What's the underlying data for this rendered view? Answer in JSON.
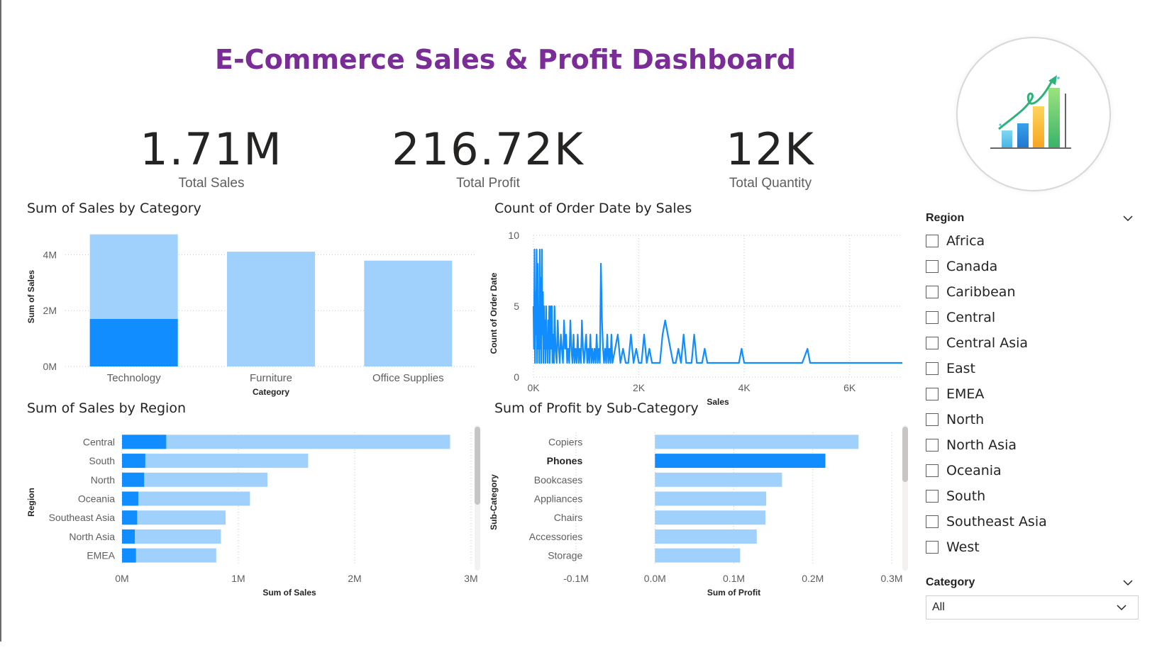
{
  "dashboard": {
    "title": "E-Commerce Sales & Profit Dashboard",
    "accent_color": "#7a2d96",
    "logo_icon": "growth-chart-icon"
  },
  "kpis": [
    {
      "value": "1.71M",
      "label": "Total Sales"
    },
    {
      "value": "216.72K",
      "label": "Total Profit"
    },
    {
      "value": "12K",
      "label": "Total Quantity"
    }
  ],
  "chart_data": [
    {
      "id": "sales-by-category",
      "type": "bar",
      "title": "Sum of Sales by Category",
      "xlabel": "Category",
      "ylabel": "Sum of Sales",
      "categories": [
        "Technology",
        "Furniture",
        "Office Supplies"
      ],
      "values": [
        4730000,
        4110000,
        3790000
      ],
      "highlighted_values": [
        1700000,
        null,
        null
      ],
      "yticks": [
        "0M",
        "2M",
        "4M"
      ],
      "ylim": [
        0,
        5000000
      ],
      "grid": true,
      "colors": {
        "base": "#a0d1fc",
        "highlight": "#118dff"
      }
    },
    {
      "id": "order-date-by-sales",
      "type": "line",
      "title": "Count of Order Date by Sales",
      "xlabel": "Sales",
      "ylabel": "Count of Order Date",
      "xticks": [
        "0K",
        "2K",
        "4K",
        "6K"
      ],
      "yticks": [
        "0",
        "5",
        "10"
      ],
      "xlim": [
        0,
        7000
      ],
      "ylim": [
        0,
        10
      ],
      "grid": true,
      "color": "#118dff",
      "x": [
        0,
        10,
        20,
        30,
        40,
        50,
        60,
        70,
        80,
        90,
        100,
        110,
        120,
        130,
        140,
        150,
        160,
        170,
        180,
        190,
        200,
        210,
        220,
        230,
        240,
        250,
        260,
        270,
        280,
        290,
        300,
        310,
        320,
        330,
        340,
        350,
        360,
        370,
        380,
        390,
        400,
        420,
        440,
        460,
        480,
        500,
        520,
        540,
        560,
        580,
        600,
        620,
        640,
        660,
        680,
        700,
        720,
        740,
        760,
        780,
        800,
        820,
        840,
        860,
        880,
        900,
        920,
        940,
        960,
        980,
        1000,
        1020,
        1040,
        1060,
        1080,
        1100,
        1120,
        1140,
        1160,
        1180,
        1200,
        1220,
        1240,
        1260,
        1280,
        1300,
        1320,
        1340,
        1360,
        1380,
        1400,
        1420,
        1440,
        1460,
        1480,
        1500,
        1550,
        1600,
        1650,
        1700,
        1750,
        1800,
        1850,
        1900,
        1950,
        2000,
        2050,
        2100,
        2150,
        2200,
        2250,
        2300,
        2350,
        2400,
        2450,
        2500,
        2550,
        2600,
        2650,
        2700,
        2750,
        2800,
        2850,
        2900,
        2950,
        3000,
        3050,
        3100,
        3150,
        3200,
        3250,
        3300,
        3400,
        3500,
        3600,
        3700,
        3800,
        3900,
        3950,
        4000,
        4050,
        4100,
        4300,
        4600,
        4900,
        5100,
        5200,
        5250,
        5300,
        5500,
        5900,
        6300,
        6700,
        7000
      ],
      "y": [
        5,
        2,
        9,
        1,
        6,
        3,
        9,
        1,
        8,
        2,
        5,
        1,
        9,
        2,
        7,
        1,
        9,
        3,
        6,
        1,
        5,
        2,
        4,
        1,
        5,
        2,
        3,
        1,
        4,
        2,
        5,
        1,
        3,
        5,
        2,
        5,
        1,
        3,
        2,
        1,
        5,
        2,
        1,
        4,
        2,
        1,
        3,
        2,
        1,
        4,
        2,
        3,
        1,
        2,
        1,
        4,
        2,
        1,
        3,
        1,
        2,
        1,
        3,
        1,
        2,
        1,
        4,
        2,
        1,
        2,
        3,
        1,
        2,
        1,
        3,
        1,
        2,
        1,
        2,
        1,
        3,
        1,
        2,
        1,
        8,
        4,
        2,
        1,
        2,
        1,
        3,
        1,
        2,
        1,
        3,
        1,
        2,
        3,
        1,
        2,
        1,
        1,
        3,
        1,
        2,
        1,
        1,
        3,
        1,
        2,
        1,
        1,
        1,
        1,
        3,
        4,
        3,
        2,
        1,
        1,
        2,
        1,
        3,
        1,
        1,
        1,
        3,
        1,
        1,
        1,
        2,
        1,
        1,
        1,
        1,
        1,
        1,
        1,
        2,
        1,
        1,
        1,
        1,
        1,
        1,
        1,
        2,
        1,
        1,
        1,
        1,
        1,
        1,
        1
      ]
    },
    {
      "id": "sales-by-region",
      "type": "bar",
      "orientation": "horizontal",
      "title": "Sum of Sales by Region",
      "xlabel": "Sum of Sales",
      "ylabel": "Region",
      "categories": [
        "Central",
        "South",
        "North",
        "Oceania",
        "Southeast Asia",
        "North Asia",
        "EMEA"
      ],
      "values": [
        2820000,
        1600000,
        1250000,
        1100000,
        890000,
        850000,
        810000
      ],
      "highlighted_values": [
        380000,
        200000,
        190000,
        140000,
        130000,
        110000,
        120000
      ],
      "xticks": [
        "0M",
        "1M",
        "2M",
        "3M"
      ],
      "xlim": [
        0,
        3000000
      ],
      "grid": true,
      "colors": {
        "base": "#a0d1fc",
        "highlight": "#118dff"
      }
    },
    {
      "id": "profit-by-subcategory",
      "type": "bar",
      "orientation": "horizontal",
      "title": "Sum of Profit by Sub-Category",
      "xlabel": "Sum of Profit",
      "ylabel": "Sub-Category",
      "categories": [
        "Copiers",
        "Phones",
        "Bookcases",
        "Appliances",
        "Chairs",
        "Accessories",
        "Storage"
      ],
      "values": [
        258000,
        216000,
        161000,
        141000,
        140000,
        129000,
        108000
      ],
      "selected_category": "Phones",
      "xticks": [
        "-0.1M",
        "0.0M",
        "0.1M",
        "0.2M",
        "0.3M"
      ],
      "xlim": [
        -100000,
        300000
      ],
      "grid": true,
      "colors": {
        "base": "#a0d1fc",
        "highlight": "#118dff"
      }
    }
  ],
  "slicers": {
    "region": {
      "title": "Region",
      "items": [
        "Africa",
        "Canada",
        "Caribbean",
        "Central",
        "Central Asia",
        "East",
        "EMEA",
        "North",
        "North Asia",
        "Oceania",
        "South",
        "Southeast Asia",
        "West"
      ]
    },
    "category": {
      "title": "Category",
      "selected": "All"
    }
  }
}
